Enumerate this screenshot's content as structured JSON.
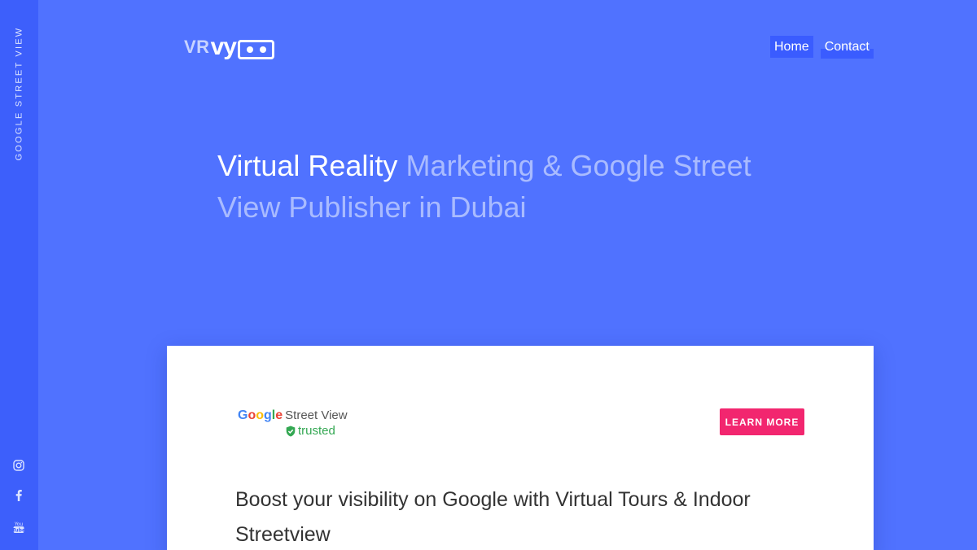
{
  "sidebar": {
    "label": "GOOGLE STREET VIEW",
    "social": [
      {
        "icon": "instagram-icon"
      },
      {
        "icon": "facebook-icon"
      },
      {
        "icon": "youtube-icon"
      }
    ]
  },
  "logo": {
    "vr": "VR",
    "vy": "vy"
  },
  "nav": {
    "home": "Home",
    "contact": "Contact"
  },
  "hero": {
    "strong": "Virtual Reality",
    "rest": " Marketing & Google Street View Publisher in Dubai"
  },
  "card": {
    "badge": {
      "google": [
        "G",
        "o",
        "o",
        "g",
        "l",
        "e"
      ],
      "google_colors": [
        "#4285f4",
        "#ea4335",
        "#fbbc05",
        "#4285f4",
        "#34a853",
        "#ea4335"
      ],
      "street_view": "Street View",
      "trusted": "trusted",
      "trusted_color": "#34a853"
    },
    "learn_more": "LEARN MORE",
    "heading": "Boost your visibility on Google with Virtual Tours & Indoor Streetview"
  },
  "colors": {
    "background": "#5072ff",
    "sidebar": "#3d5ffb",
    "accent_button": "#f2266f",
    "hero_soft_text": "#a9bbff"
  }
}
